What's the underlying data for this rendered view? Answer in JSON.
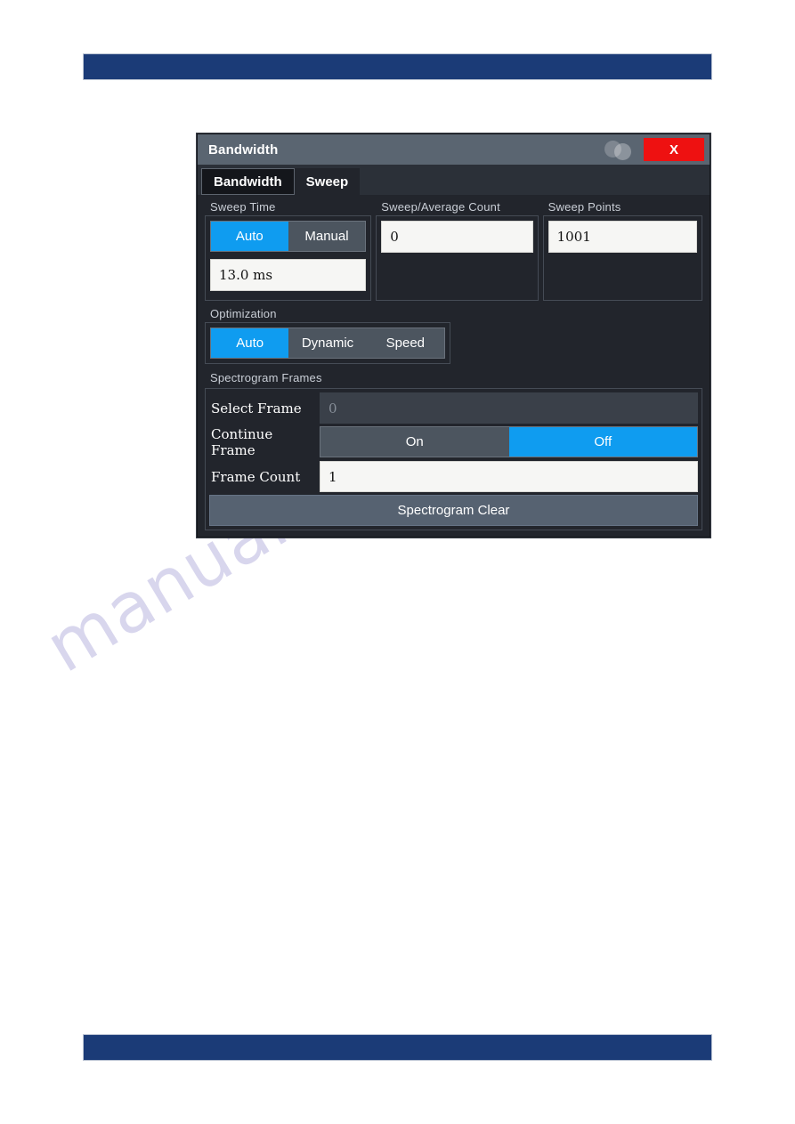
{
  "page": {
    "top_bar": "",
    "bottom_bar": "",
    "watermark": "manualshive.com"
  },
  "dialog": {
    "title": "Bandwidth",
    "close_label": "X",
    "tabs": [
      {
        "label": "Bandwidth",
        "active": false
      },
      {
        "label": "Sweep",
        "active": true
      }
    ],
    "sweep_time": {
      "legend": "Sweep Time",
      "mode_options": [
        "Auto",
        "Manual"
      ],
      "mode_selected": "Auto",
      "value": "13.0 ms"
    },
    "sweep_average_count": {
      "legend": "Sweep/Average Count",
      "value": "0"
    },
    "sweep_points": {
      "legend": "Sweep Points",
      "value": "1001"
    },
    "optimization": {
      "legend": "Optimization",
      "options": [
        "Auto",
        "Dynamic",
        "Speed"
      ],
      "selected": "Auto"
    },
    "spectrogram_frames": {
      "legend": "Spectrogram Frames",
      "select_frame": {
        "label": "Select Frame",
        "value": "0",
        "enabled": false
      },
      "continue_frame": {
        "label": "Continue Frame",
        "options": [
          "On",
          "Off"
        ],
        "selected": "Off"
      },
      "frame_count": {
        "label": "Frame Count",
        "value": "1"
      },
      "clear_button": "Spectrogram Clear"
    }
  },
  "colors": {
    "accent_blue": "#0f9cf0",
    "close_red": "#ee1111",
    "dialog_bg": "#22252c",
    "titlebar": "#5a6571",
    "page_bar": "#1b3b77",
    "watermark": "#4338a8"
  }
}
